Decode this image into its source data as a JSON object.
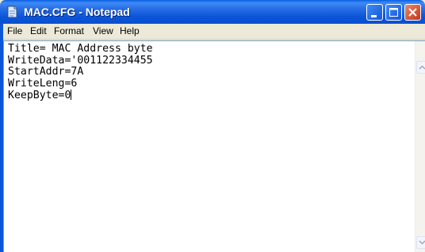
{
  "window": {
    "title": "MAC.CFG - Notepad",
    "app_icon": "notepad-icon",
    "titlebar_color": "#0a55d8"
  },
  "menu": {
    "items": [
      {
        "label": "File"
      },
      {
        "label": "Edit"
      },
      {
        "label": "Format"
      },
      {
        "label": "View"
      },
      {
        "label": "Help"
      }
    ]
  },
  "editor": {
    "lines": [
      "Title= MAC Address byte",
      "WriteData='001122334455",
      "StartAddr=7A",
      "WriteLeng=6",
      "KeepByte=0"
    ]
  },
  "controls": {
    "minimize_icon": "minimize-icon",
    "maximize_icon": "maximize-icon",
    "close_icon": "close-icon",
    "close_color": "#c4331b"
  }
}
